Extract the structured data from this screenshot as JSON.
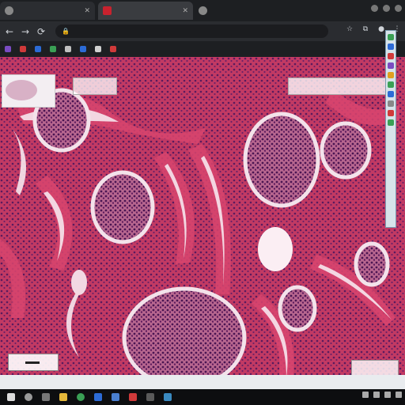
{
  "browser": {
    "tabs": [
      {
        "label": "",
        "favicon": "page-icon"
      },
      {
        "label": "",
        "favicon": "youtube-icon"
      },
      {
        "label": "",
        "favicon": "globe-icon"
      }
    ],
    "address": "",
    "bookmarks": [
      {
        "label": "",
        "icon": "bookmark-icon",
        "color": "#7a4cc2"
      },
      {
        "label": "",
        "icon": "bookmark-icon",
        "color": "#d03a3a"
      },
      {
        "label": "",
        "icon": "bookmark-icon",
        "color": "#2c6bd6"
      },
      {
        "label": "",
        "icon": "bookmark-icon",
        "color": "#3aa055"
      },
      {
        "label": "",
        "icon": "bookmark-icon",
        "color": "#c0c0c0"
      },
      {
        "label": "",
        "icon": "bookmark-icon",
        "color": "#2c6bd6"
      },
      {
        "label": "",
        "icon": "bookmark-icon",
        "color": "#d0d0d0"
      },
      {
        "label": "",
        "icon": "bookmark-icon",
        "color": "#d03a3a"
      }
    ]
  },
  "viewer": {
    "scale_label": "",
    "colors": {
      "tissue": "#b52a52",
      "tubule": "#d9456e",
      "nuclei": "#5a1a5e",
      "lumen": "#f7e7ee"
    }
  },
  "taskbar": {
    "icons": [
      "start-icon",
      "search-icon",
      "task-view-icon",
      "file-explorer-icon",
      "browser-icon",
      "mail-icon",
      "store-icon",
      "app-icon",
      "app-icon",
      "app-icon"
    ]
  }
}
